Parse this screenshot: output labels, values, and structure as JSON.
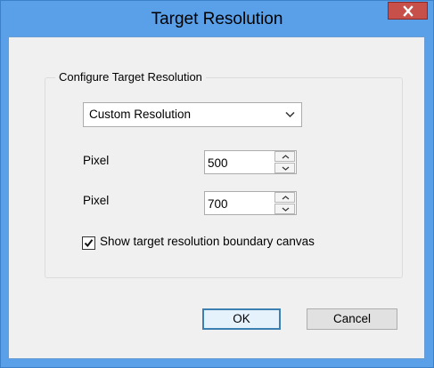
{
  "window": {
    "title": "Target Resolution",
    "close_glyph": "x"
  },
  "group": {
    "legend": "Configure Target Resolution"
  },
  "resolution_select": {
    "selected": "Custom Resolution"
  },
  "width_row": {
    "label": "Pixel",
    "value": "500"
  },
  "height_row": {
    "label": "Pixel",
    "value": "700"
  },
  "boundary_checkbox": {
    "checked": true,
    "label": "Show target resolution boundary canvas"
  },
  "buttons": {
    "ok_label": "OK",
    "cancel_label": "Cancel"
  },
  "colors": {
    "title_bar": "#5aa0e8",
    "close_button": "#c7504b",
    "dialog_background": "#f0f0f0"
  }
}
